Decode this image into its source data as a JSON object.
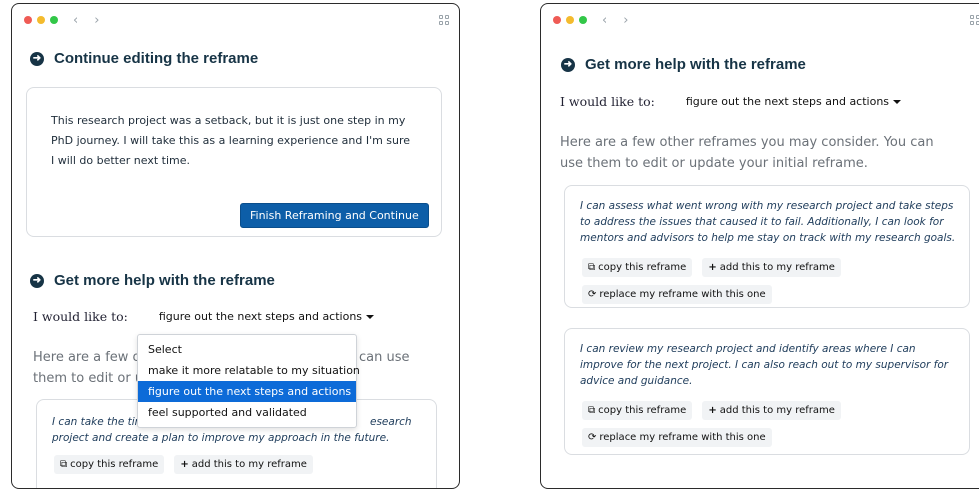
{
  "browser": {
    "back": "‹",
    "forward": "›"
  },
  "left": {
    "continue_title": "Continue editing the reframe",
    "reframe_text": "This research project was a setback, but it is just one step in my PhD journey. I will take this as a learning experience and I'm sure I will do better next time.",
    "finish_button": "Finish Reframing and Continue",
    "help_title": "Get more help with the reframe",
    "like_label": "I would like to:",
    "selected_option": "figure out the next steps and actions",
    "hint_visible_1": "Here are a few ot",
    "hint_visible_1b": "can use",
    "hint_visible_2": "them to edit or u",
    "alt_visible_1": "I can take the tin",
    "alt_visible_1b": "esearch",
    "alt_visible_2": "project and create a plan to improve my approach in the future.",
    "copy_label": "copy this reframe",
    "add_label": "add this to my reframe",
    "dropdown": [
      "Select",
      "make it more relatable to my situation",
      "figure out the next steps and actions",
      "feel supported and validated"
    ]
  },
  "right": {
    "help_title": "Get more help with the reframe",
    "like_label": "I would like to:",
    "selected_option": "figure out the next steps and actions",
    "hint": "Here are a few other reframes you may consider. You can use them to edit or update your initial reframe.",
    "alternatives": [
      {
        "text": "I can assess what went wrong with my research project and take steps to address the issues that caused it to fail. Additionally, I can look for mentors and advisors to help me stay on track with my research goals."
      },
      {
        "text": "I can review my research project and identify areas where I can improve for the next project. I can also reach out to my supervisor for advice and guidance."
      }
    ],
    "copy_label": "copy this reframe",
    "add_label": "add this to my reframe",
    "replace_label": "replace my reframe with this one"
  }
}
